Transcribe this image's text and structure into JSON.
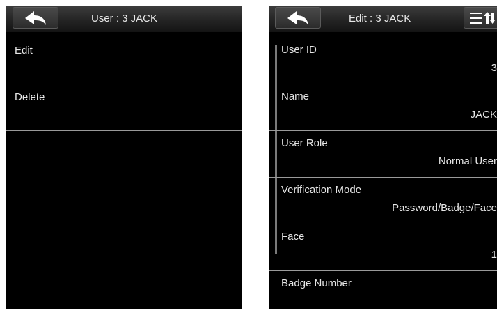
{
  "left_screen": {
    "title": "User : 3 JACK",
    "menu": [
      {
        "label": "Edit"
      },
      {
        "label": "Delete"
      }
    ]
  },
  "right_screen": {
    "title": "Edit : 3 JACK",
    "fields": [
      {
        "label": "User ID",
        "value": "3"
      },
      {
        "label": "Name",
        "value": "JACK"
      },
      {
        "label": "User Role",
        "value": "Normal User"
      },
      {
        "label": "Verification Mode",
        "value": "Password/Badge/Face"
      },
      {
        "label": "Face",
        "value": "1"
      },
      {
        "label": "Badge Number",
        "value": ""
      }
    ]
  },
  "icons": {
    "back": "back-arrow-icon",
    "sort": "sort-list-icon"
  },
  "colors": {
    "screen_background": "#000000",
    "text": "#e6e6e6",
    "divider": "#9a9a9a"
  }
}
